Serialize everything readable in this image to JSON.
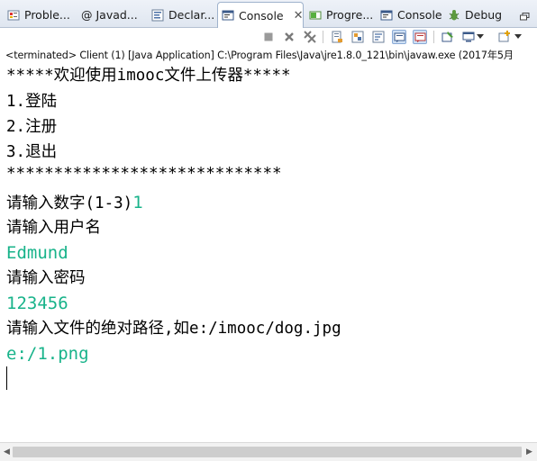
{
  "tabs": [
    {
      "label": "Proble...",
      "icon": "problems-icon"
    },
    {
      "label": "@ Javad...",
      "icon": "javadoc-icon"
    },
    {
      "label": "Declar...",
      "icon": "declaration-icon"
    },
    {
      "label": "Console",
      "icon": "console-icon",
      "active": true
    },
    {
      "label": "Progre...",
      "icon": "progress-icon"
    },
    {
      "label": "Console",
      "icon": "console-icon"
    },
    {
      "label": "Debug",
      "icon": "debug-icon"
    }
  ],
  "active_close": "✕",
  "status": "<terminated> Client (1) [Java Application] C:\\Program Files\\Java\\jre1.8.0_121\\bin\\javaw.exe (2017年5月",
  "console": {
    "lines": [
      {
        "text": "*****欢迎使用imooc文件上传器*****",
        "kind": "out"
      },
      {
        "text": "1.登陆",
        "kind": "out"
      },
      {
        "text": "2.注册",
        "kind": "out"
      },
      {
        "text": "3.退出",
        "kind": "out"
      },
      {
        "text": "*****************************",
        "kind": "out"
      },
      {
        "prompt": "请输入数字(1-3)",
        "input": "1",
        "kind": "mixed"
      },
      {
        "text": "请输入用户名",
        "kind": "out"
      },
      {
        "text": "Edmund",
        "kind": "in"
      },
      {
        "text": "请输入密码",
        "kind": "out"
      },
      {
        "text": "123456",
        "kind": "in"
      },
      {
        "text": "请输入文件的绝对路径,如e:/imooc/dog.jpg",
        "kind": "out"
      },
      {
        "text": "e:/1.png",
        "kind": "in"
      }
    ]
  },
  "colors": {
    "input_text": "#18b38a",
    "output_text": "#000000",
    "tab_active_bg": "#ffffff",
    "tabbar_bg": "#dfe6f0"
  }
}
